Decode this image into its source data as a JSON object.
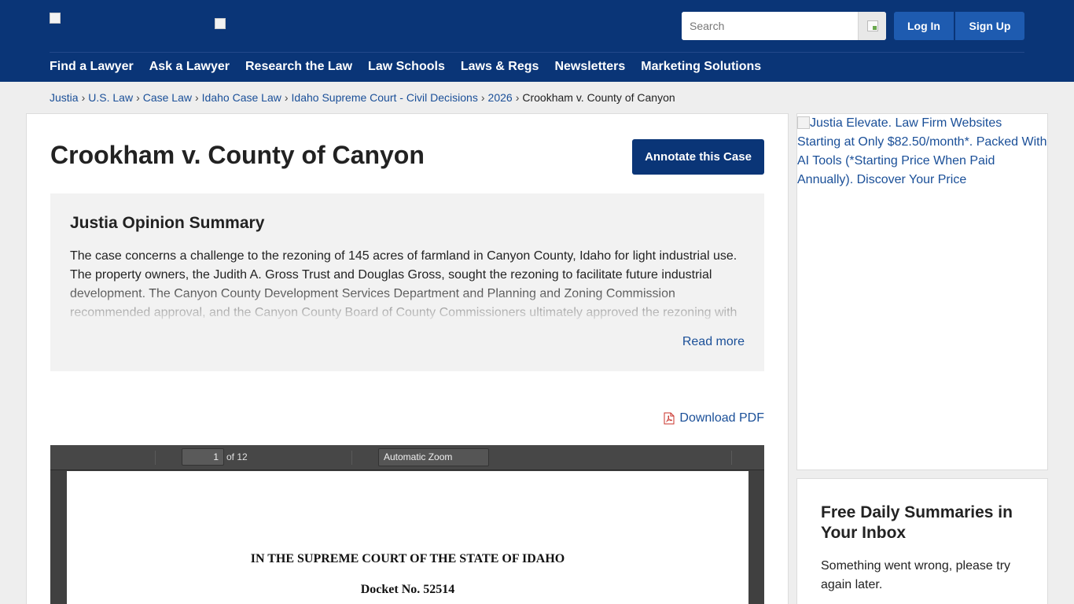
{
  "header": {
    "search": {
      "placeholder": "Search"
    },
    "login_label": "Log In",
    "signup_label": "Sign Up",
    "nav": [
      "Find a Lawyer",
      "Ask a Lawyer",
      "Research the Law",
      "Law Schools",
      "Laws & Regs",
      "Newsletters",
      "Marketing Solutions"
    ]
  },
  "breadcrumb": {
    "items": [
      "Justia",
      "U.S. Law",
      "Case Law",
      "Idaho Case Law",
      "Idaho Supreme Court - Civil Decisions",
      "2026"
    ],
    "current": "Crookham v. County of Canyon",
    "separator": "›"
  },
  "case": {
    "title": "Crookham v. County of Canyon",
    "annotate_label": "Annotate this Case"
  },
  "summary": {
    "heading": "Justia Opinion Summary",
    "text": "The case concerns a challenge to the rezoning of 145 acres of farmland in Canyon County, Idaho for light industrial use. The property owners, the Judith A. Gross Trust and Douglas Gross, sought the rezoning to facilitate future industrial development. The Canyon County Development Services Department and Planning and Zoning Commission recommended approval, and the Canyon County Board of County Commissioners ultimately approved the rezoning with",
    "read_more": "Read more"
  },
  "download": {
    "label": "Download PDF"
  },
  "viewer": {
    "page_number": "1",
    "page_count": "of 12",
    "zoom": "Automatic Zoom",
    "line1": "IN THE SUPREME COURT OF THE STATE OF IDAHO",
    "line2": "Docket No. 52514"
  },
  "sidebar": {
    "ad_alt": "Justia Elevate. Law Firm Websites Starting at Only $82.50/month*. Packed With AI Tools (*Starting Price When Paid Annually). Discover Your Price",
    "newsletter_heading": "Free Daily Summaries in Your Inbox",
    "newsletter_message": "Something went wrong, please try again later."
  },
  "colors": {
    "header_bg": "#0a3577",
    "button_blue": "#1e5bb0",
    "link": "#1a4f98"
  }
}
